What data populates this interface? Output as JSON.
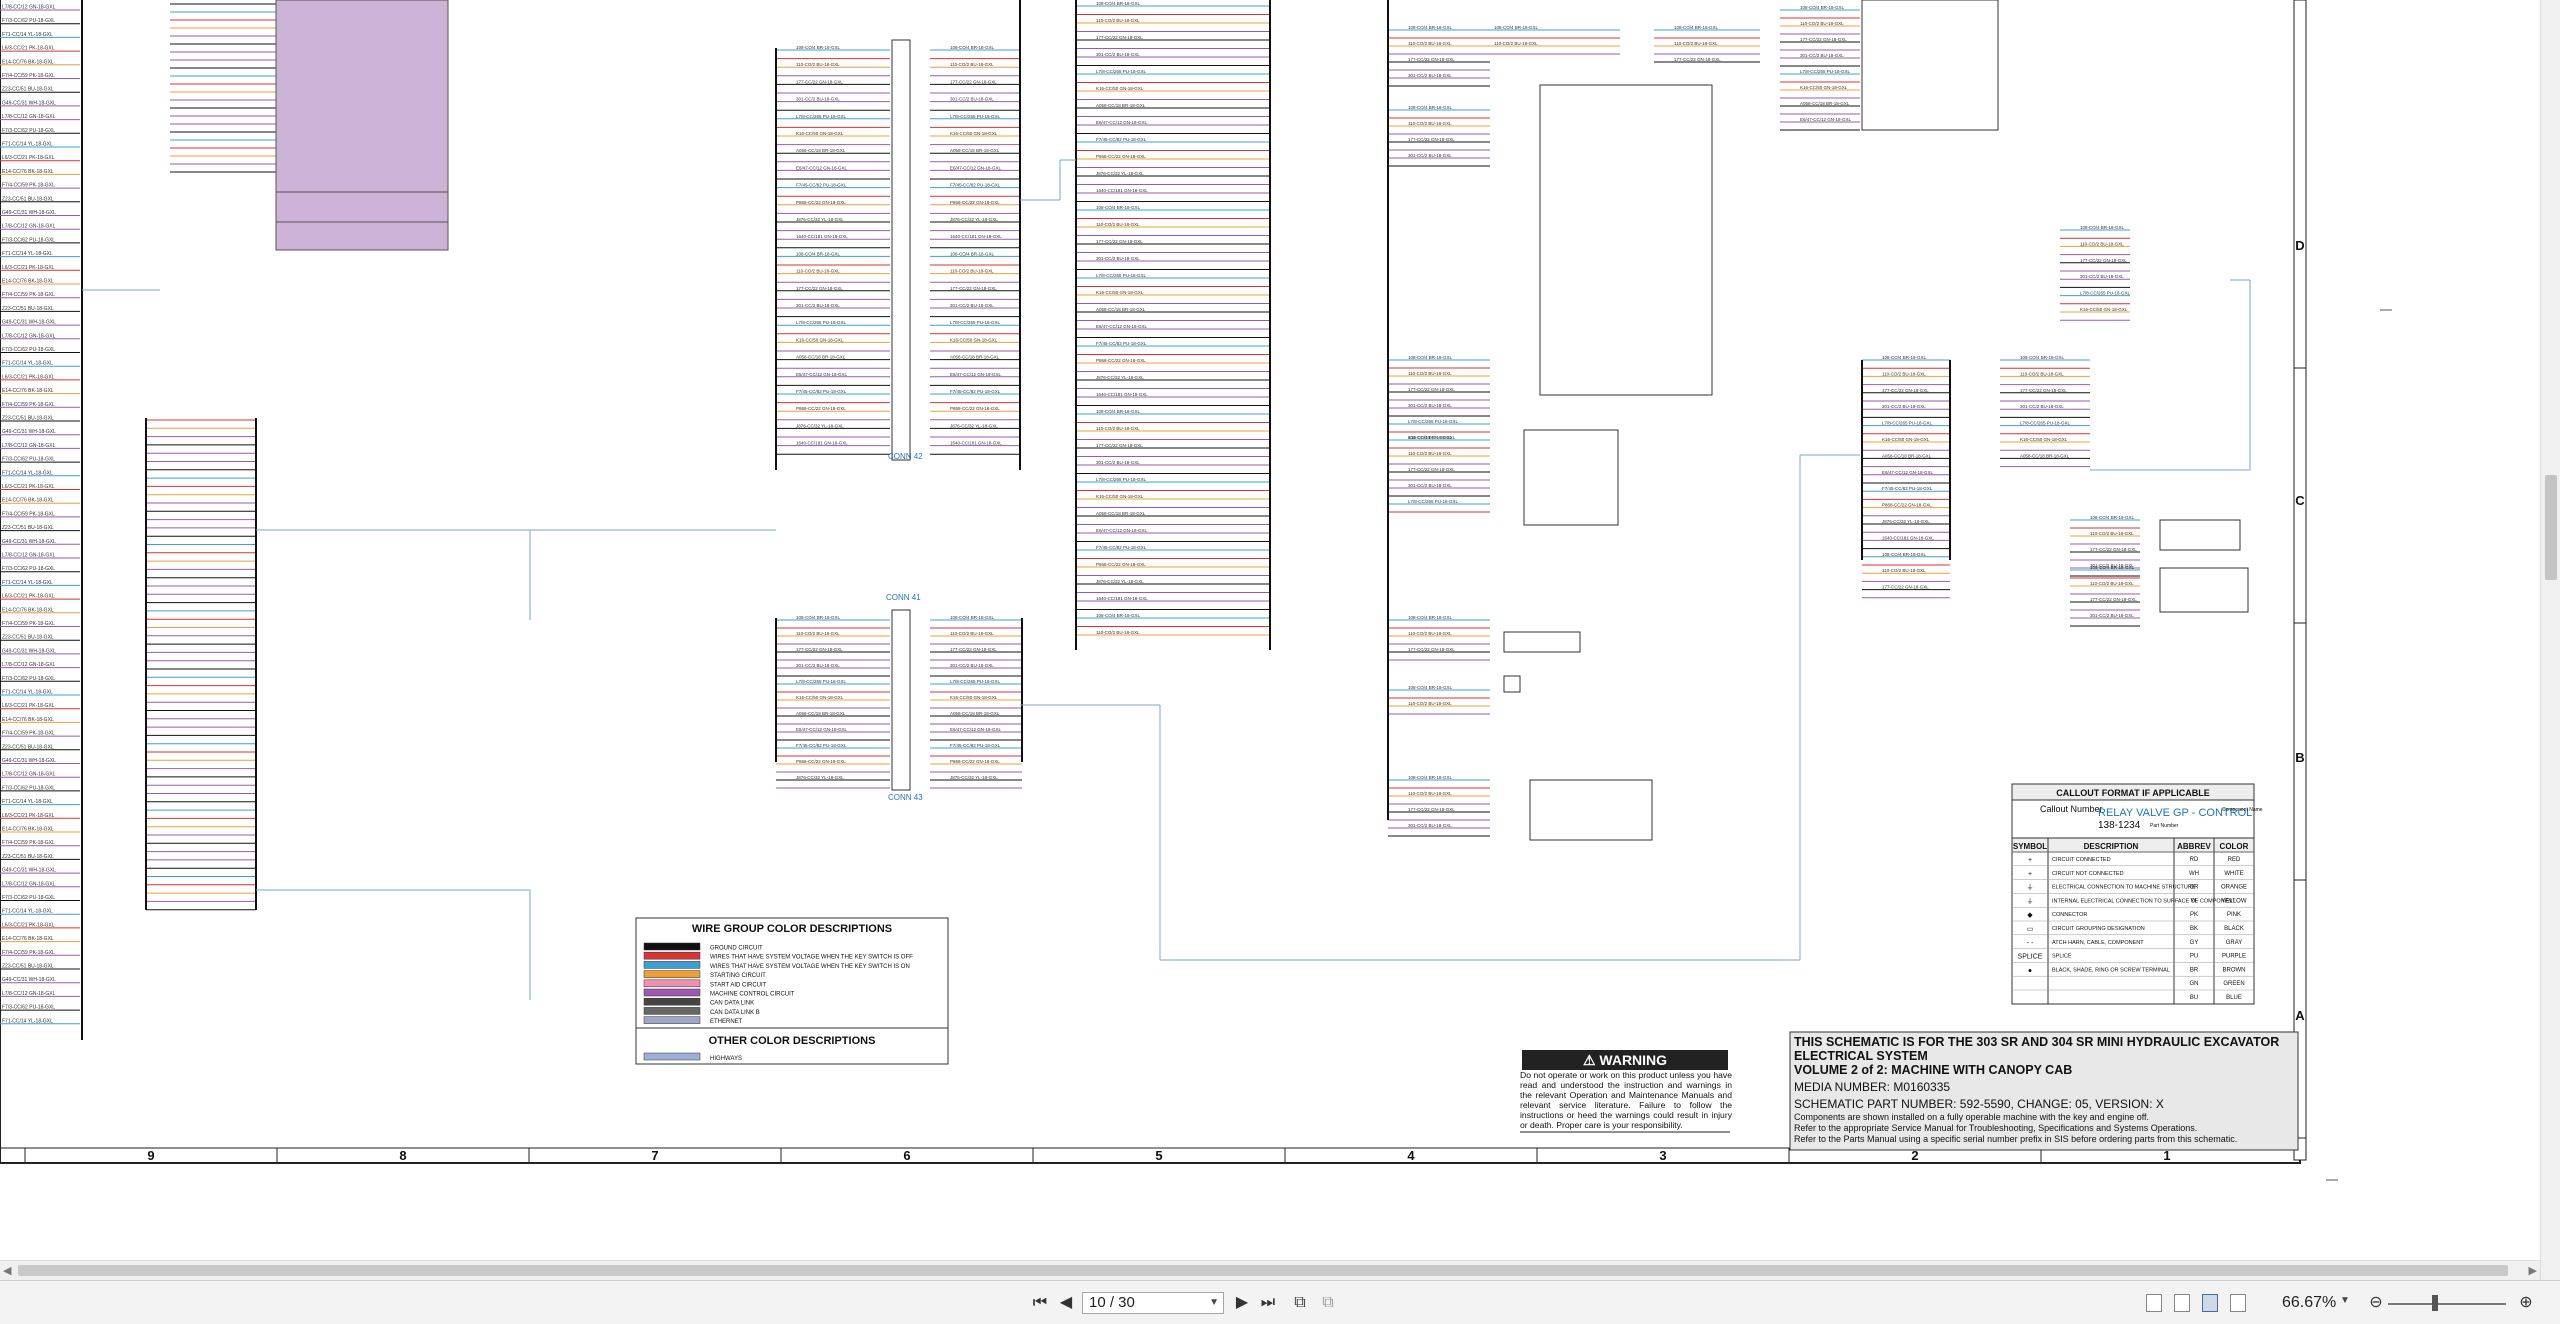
{
  "schematic": {
    "zone_rows": [
      "D",
      "C",
      "B",
      "A"
    ],
    "zone_columns": [
      "9",
      "8",
      "7",
      "6",
      "5",
      "4",
      "3",
      "2",
      "1"
    ],
    "connector_labels": [
      "CONN 42",
      "CONN 41",
      "CONN 43"
    ],
    "left_wire_labels": [
      "L7/8-CC/12 GN-18-GXL",
      "F7/3-CC/62 PU-18-GXL",
      "F71-CC/14 YL-18-GXL",
      "L6/3-CC/21 PK-18-GXL",
      "E14-CC/76 BK-18-GXL",
      "F7/4-CC/59 PK-18-GXL",
      "Z23-CC/51 BU-18-GXL",
      "G49-CC/31 WH-18-GXL"
    ],
    "center_wire_labels": [
      "108-CO/4 BR-18-GXL",
      "110-CO/2 BU-18-GXL",
      "177-CC/22 GN-18-GXL",
      "301-CC/2 BU-18-GXL",
      "L7/8-CC/265 PU-18-GXL",
      "K16-CC/50 GN-18-GXL",
      "A058-CC/18 BR-18-GXL",
      "E6/47-CC/12 GN-18-GXL",
      "F7/45-CC/82 PU-18-GXL",
      "P868-CC/22 GN-18-GXL",
      "J876-CC/32 YL-18-GXL",
      "1640-CC/181 GN-18-GXL"
    ],
    "legend": {
      "title": "WIRE GROUP COLOR DESCRIPTIONS",
      "items": [
        {
          "label": "GROUND CIRCUIT",
          "color": "#111111"
        },
        {
          "label": "WIRES THAT HAVE SYSTEM VOLTAGE WHEN THE KEY SWITCH IS OFF",
          "color": "#e03030"
        },
        {
          "label": "WIRES THAT HAVE SYSTEM VOLTAGE WHEN THE KEY SWITCH IS ON",
          "color": "#3aa0d8"
        },
        {
          "label": "STARTING CIRCUIT",
          "color": "#f0a030"
        },
        {
          "label": "START AID CIRCUIT",
          "color": "#f090b0"
        },
        {
          "label": "MACHINE CONTROL CIRCUIT",
          "color": "#9a5ab0"
        },
        {
          "label": "CAN DATA LINK",
          "color": "#444444"
        },
        {
          "label": "CAN DATA LINK B",
          "color": "#666666"
        },
        {
          "label": "ETHERNET",
          "color": "#a0a8c8"
        }
      ],
      "other_title": "OTHER COLOR DESCRIPTIONS",
      "other_items": [
        {
          "label": "HIGHWAYS",
          "color": "#9ab0d8"
        }
      ]
    },
    "warning": {
      "title": "WARNING",
      "text": "Do not operate or work on this product unless you have read and understood the instruction and warnings in the relevant Operation and Maintenance Manuals and relevant service literature. Failure to follow the instructions or heed the warnings could result in injury or death. Proper care is your responsibility."
    },
    "callout": {
      "title": "CALLOUT FORMAT IF APPLICABLE",
      "callout_number": "Callout Number",
      "component_name": "RELAY VALVE GP - CONTROL",
      "part_number": "138-1234",
      "part_number_label": "Part Number",
      "component_label": "Component Name",
      "headers": [
        "SYMBOL",
        "DESCRIPTION",
        "ABBREV",
        "COLOR"
      ],
      "rows": [
        {
          "symbol": "+",
          "description": "CIRCUIT CONNECTED",
          "abbrev": "RD",
          "color": "RED"
        },
        {
          "symbol": "+",
          "description": "CIRCUIT NOT CONNECTED",
          "abbrev": "WH",
          "color": "WHITE"
        },
        {
          "symbol": "⏚",
          "description": "ELECTRICAL CONNECTION TO MACHINE STRUCTURE",
          "abbrev": "OR",
          "color": "ORANGE"
        },
        {
          "symbol": "⏚",
          "description": "INTERNAL ELECTRICAL CONNECTION TO SURFACE OF COMPONENT",
          "abbrev": "YL",
          "color": "YELLOW"
        },
        {
          "symbol": "◆",
          "description": "CONNECTOR",
          "abbrev": "PK",
          "color": "PINK"
        },
        {
          "symbol": "▭",
          "description": "CIRCUIT GROUPING DESIGNATION",
          "abbrev": "BK",
          "color": "BLACK"
        },
        {
          "symbol": "- -",
          "description": "ATCH HARN, CABLE, COMPONENT",
          "abbrev": "GY",
          "color": "GRAY"
        },
        {
          "symbol": "SPLICE",
          "description": "SPLICE",
          "abbrev": "PU",
          "color": "PURPLE"
        },
        {
          "symbol": "●",
          "description": "BLACK, SHADE, RING OR SCREW TERMINAL",
          "abbrev": "BR",
          "color": "BROWN"
        },
        {
          "symbol": "",
          "description": "",
          "abbrev": "GN",
          "color": "GREEN"
        },
        {
          "symbol": "",
          "description": "",
          "abbrev": "BU",
          "color": "BLUE"
        }
      ]
    },
    "title_block": {
      "line1": "THIS SCHEMATIC IS FOR THE 303 SR AND 304 SR MINI HYDRAULIC EXCAVATOR",
      "line2": "ELECTRICAL SYSTEM",
      "line3": "VOLUME 2 of 2: MACHINE WITH CANOPY CAB",
      "media": "MEDIA NUMBER: M0160335",
      "part": "SCHEMATIC PART NUMBER: 592-5590, CHANGE: 05, VERSION: X",
      "note1": "Components are shown installed on a fully operable machine with the key and engine off.",
      "note2": "Refer to the appropriate Service Manual for Troubleshooting, Specifications and Systems Operations.",
      "note3": "Refer to the Parts Manual using a specific serial number prefix in SIS before ordering parts from this schematic."
    }
  },
  "toolbar": {
    "page_value": "10 / 30",
    "zoom_value": "66.67%",
    "icons": [
      "first-page-icon",
      "prev-page-icon",
      "next-page-icon",
      "last-page-icon",
      "prev-view-icon",
      "next-view-icon",
      "single-page-view-icon",
      "continuous-view-icon",
      "two-page-view-icon",
      "two-page-continuous-view-icon",
      "zoom-out-icon",
      "zoom-in-icon"
    ]
  }
}
